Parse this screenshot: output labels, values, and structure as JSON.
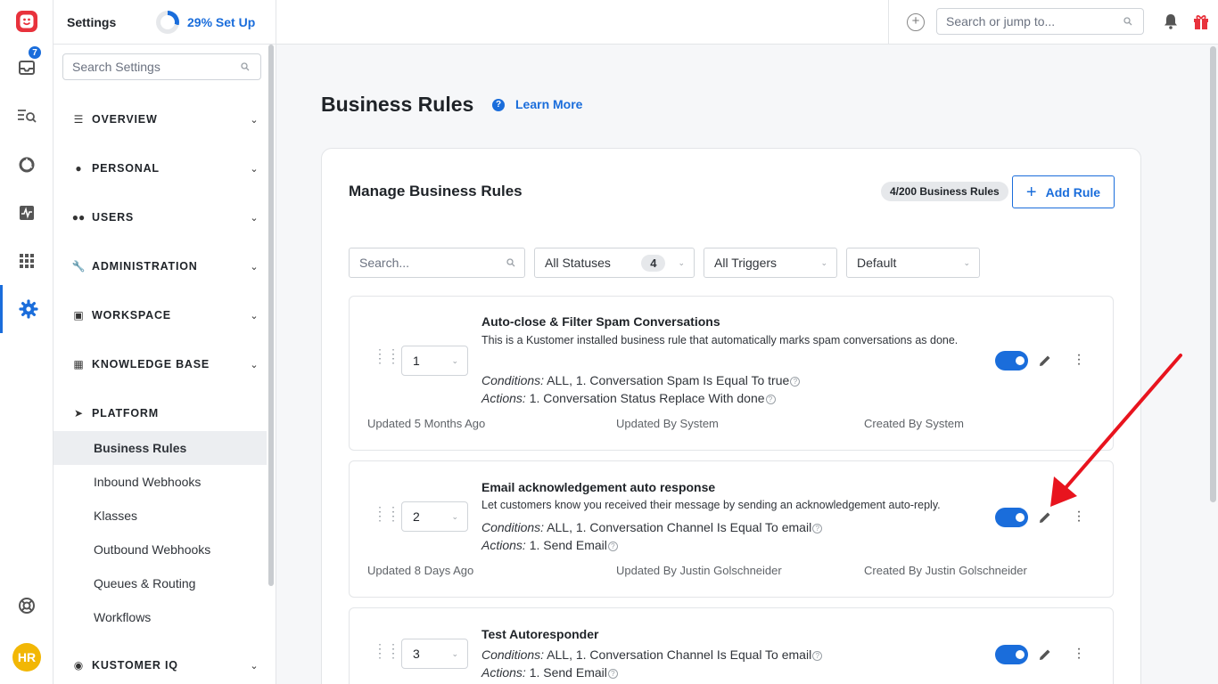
{
  "rail": {
    "inbox_badge": "7",
    "avatar_initials": "HR"
  },
  "sidebar": {
    "title": "Settings",
    "setup_label": "29% Set Up",
    "setup_progress": 0.29,
    "search_placeholder": "Search Settings",
    "sections": [
      {
        "label": "OVERVIEW"
      },
      {
        "label": "PERSONAL"
      },
      {
        "label": "USERS"
      },
      {
        "label": "ADMINISTRATION"
      },
      {
        "label": "WORKSPACE"
      },
      {
        "label": "KNOWLEDGE BASE"
      },
      {
        "label": "PLATFORM"
      },
      {
        "label": "KUSTOMER IQ"
      }
    ],
    "platform_items": [
      {
        "label": "Business Rules"
      },
      {
        "label": "Inbound Webhooks"
      },
      {
        "label": "Klasses"
      },
      {
        "label": "Outbound Webhooks"
      },
      {
        "label": "Queues & Routing"
      },
      {
        "label": "Workflows"
      }
    ]
  },
  "topbar": {
    "search_placeholder": "Search or jump to..."
  },
  "main": {
    "title": "Business Rules",
    "learn_more": "Learn More",
    "card_title": "Manage Business Rules",
    "count_label": "4/200 Business Rules",
    "add_rule_label": "Add Rule",
    "filters": {
      "search_placeholder": "Search...",
      "statuses": "All Statuses",
      "statuses_count": "4",
      "triggers": "All Triggers",
      "sort": "Default"
    },
    "rules": [
      {
        "order": "1",
        "title": "Auto-close & Filter Spam Conversations",
        "description": "This is a Kustomer installed business rule that automatically marks spam conversations as done.",
        "conditions_label": "Conditions:",
        "conditions": " ALL, 1. Conversation Spam Is Equal To true",
        "actions_label": "Actions:",
        "actions": " 1. Conversation Status Replace With done",
        "updated": "Updated 5 Months Ago",
        "updated_by": "Updated By System",
        "created_by": "Created By System",
        "enabled": true
      },
      {
        "order": "2",
        "title": "Email acknowledgement auto response",
        "description": "Let customers know you received their message by sending an acknowledgement auto-reply.",
        "conditions_label": "Conditions:",
        "conditions": " ALL, 1. Conversation Channel Is Equal To email",
        "actions_label": "Actions:",
        "actions": " 1. Send Email",
        "updated": "Updated 8 Days Ago",
        "updated_by": "Updated By Justin Golschneider",
        "created_by": "Created By Justin Golschneider",
        "enabled": true
      },
      {
        "order": "3",
        "title": "Test Autoresponder",
        "conditions_label": "Conditions:",
        "conditions": " ALL, 1. Conversation Channel Is Equal To email",
        "actions_label": "Actions:",
        "actions": " 1. Send Email",
        "enabled": true
      }
    ]
  },
  "colors": {
    "accent": "#1a6ddb",
    "annotation_arrow": "#e8141e",
    "brand": "#e8323c"
  }
}
